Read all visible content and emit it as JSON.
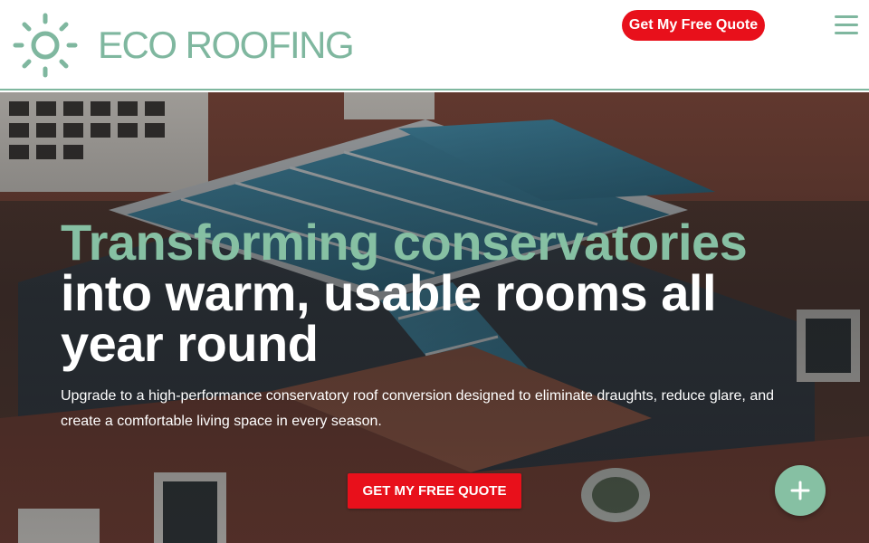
{
  "brand": {
    "name": "ECO ROOFING",
    "accent_color": "#7fb79f",
    "logo_icon": "sun-icon"
  },
  "header": {
    "cta_label": "Get My Free Quote",
    "menu_icon": "hamburger-menu-icon",
    "cta_color": "#e8101b"
  },
  "hero": {
    "background": "aerial photo of conservatory glass roof on brick house",
    "headline_accent": "Transforming conservatories",
    "headline_rest": "into warm, usable rooms all year round",
    "headline_accent_color": "#86c0a3",
    "subtext": "Upgrade to a high-performance conservatory roof conversion designed to eliminate draughts, reduce glare, and create a comfortable living space in every season.",
    "cta_label": "GET MY FREE QUOTE"
  },
  "fab": {
    "icon": "plus-icon"
  }
}
